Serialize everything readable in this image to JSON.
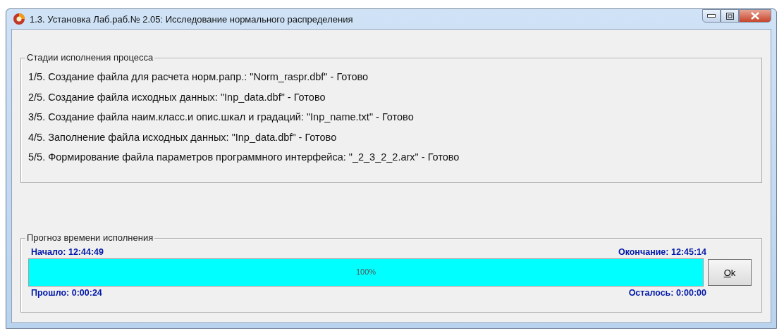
{
  "window": {
    "title": "1.3. Установка Лаб.раб.№ 2.05: Исследование нормального распределения"
  },
  "stages": {
    "title": "Стадии исполнения процесса",
    "lines": [
      "1/5. Создание файла для расчета норм.рапр.: \"Norm_raspr.dbf\" - Готово",
      "2/5. Создание файла исходных данных: \"Inp_data.dbf\" - Готово",
      "3/5. Создание файла наим.класс.и опис.шкал и градаций: \"Inp_name.txt\" - Готово",
      "4/5. Заполнение файла исходных данных: \"Inp_data.dbf\" - Готово",
      "5/5. Формирование файла параметров программного интерфейса: \"_2_3_2_2.arx\" - Готово"
    ]
  },
  "forecast": {
    "title": "Прогноз времени исполнения",
    "start": "Начало: 12:44:49",
    "end": "Окончание: 12:45:14",
    "progress": {
      "level": 1.0,
      "label": "100%"
    },
    "elapsed": "Прошло: 0:00:24",
    "remaining": "Осталось: 0:00:00",
    "button": "Ok"
  }
}
